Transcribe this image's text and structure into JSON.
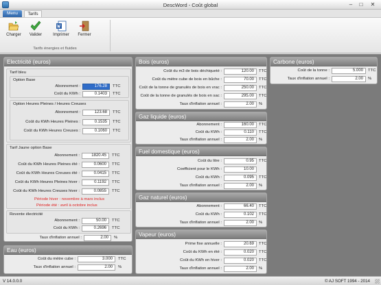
{
  "window": {
    "title": "DescWord - Coût global",
    "minimize": "–",
    "maximize": "□",
    "close": "✕"
  },
  "tabs": {
    "menu": "Menu",
    "tarifs": "Tarifs"
  },
  "ribbon": {
    "charger": "Charger",
    "valider": "Valider",
    "imprimer": "Imprimer",
    "fermer": "Fermer",
    "group": "Tarifs énergies et fluides"
  },
  "elec": {
    "title": "Electricité (euros)",
    "tarif_bleu": "Tarif bleu",
    "option_base": "Option Base",
    "base_abonnement": "Abonnement :",
    "base_abonnement_v": "176.28",
    "base_kwh": "Coût du KWh :",
    "base_kwh_v": "0.1403",
    "option_hphc": "Option Heures Pleines / Heures Creuses",
    "hp_abonnement": "Abonnement :",
    "hp_abonnement_v": "123.68",
    "hp_kwh_hp": "Coût du KWh Heures Pleines :",
    "hp_kwh_hp_v": "0.1535",
    "hp_kwh_hc": "Coût du KWh Heures Creuses :",
    "hp_kwh_hc_v": "0.1060",
    "tarif_jaune": "Tarif Jaune option Base",
    "tj_abonnement": "Abonnement :",
    "tj_abonnement_v": "1820.45",
    "tj_hp_ete": "Coût du KWh Heures Pleines été :",
    "tj_hp_ete_v": "0.0600",
    "tj_hc_ete": "Coût du KWh Heures Creuses été :",
    "tj_hc_ete_v": "0.0415",
    "tj_hp_hiver": "Coût du KWh Heures Pleines hiver :",
    "tj_hp_hiver_v": "0.1192",
    "tj_hc_hiver": "Coût du KWh Heures Creuses hiver :",
    "tj_hc_hiver_v": "0.0855",
    "periode_hiver": "Période hiver : novembre à mars inclus",
    "periode_ete": "Période été : avril à octobre inclus",
    "revente": "Revente électricité",
    "rev_abonnement": "Abonnement :",
    "rev_abonnement_v": "50.00",
    "rev_kwh": "Coût du KWh :",
    "rev_kwh_v": "0.2696",
    "inflation": "Taux d'inflation annuel :",
    "inflation_v": "2.00",
    "ttc": "TTC",
    "pct": "%"
  },
  "eau": {
    "title": "Eau (euros)",
    "m3": "Coût du mètre cube :",
    "m3_v": "3.000",
    "inflation": "Taux d'inflation annuel :",
    "inflation_v": "2.00",
    "ttc": "TTC",
    "pct": "%"
  },
  "bois": {
    "title": "Bois (euros)",
    "r1": "Coût du m3 de bois déchiqueté :",
    "r1_v": "120.00",
    "r2": "Coût du mètre cube de bois en bûche :",
    "r2_v": "70.00",
    "r3": "Coût de la tonne de granulés de bois en vrac :",
    "r3_v": "250.00",
    "r4": "Coût de la tonne de granulés de bois en sac :",
    "r4_v": "295.00",
    "inflation": "Taux d'inflation annuel :",
    "inflation_v": "2.00",
    "ttc": "TTC",
    "pct": "%"
  },
  "gaz_liquide": {
    "title": "Gaz liquide (euros)",
    "abonnement": "Abonnement :",
    "abonnement_v": "160.00",
    "kwh": "Coût du KWh :",
    "kwh_v": "0.110",
    "inflation": "Taux d'inflation annuel :",
    "inflation_v": "2.00",
    "ttc": "TTC",
    "pct": "%"
  },
  "fuel": {
    "title": "Fuel domestique (euros)",
    "litre": "Coût du litre :",
    "litre_v": "0.95",
    "coef": "Coefficient pour le KWh :",
    "coef_v": "10.00",
    "kwh": "Coût du KWh :",
    "kwh_v": "0.095",
    "inflation": "Taux d'inflation annuel :",
    "inflation_v": "2.00",
    "ttc": "TTC",
    "pct": "%"
  },
  "gaz_naturel": {
    "title": "Gaz naturel (euros)",
    "abonnement": "Abonnement :",
    "abonnement_v": "66.40",
    "kwh": "Coût du KWh :",
    "kwh_v": "0.102",
    "inflation": "Taux d'inflation annuel :",
    "inflation_v": "2.00",
    "ttc": "TTC",
    "pct": "%"
  },
  "vapeur": {
    "title": "Vapeur (euros)",
    "prime": "Prime fixe annuelle :",
    "prime_v": "20.69",
    "ete": "Coût du KWh en été :",
    "ete_v": "0.020",
    "hiver": "Coût du KWh en hiver :",
    "hiver_v": "0.020",
    "inflation": "Taux d'inflation annuel :",
    "inflation_v": "2.00",
    "ttc": "TTC",
    "pct": "%"
  },
  "carbone": {
    "title": "Carbone (euros)",
    "tonne": "Coût de la tonne :",
    "tonne_v": "5.000",
    "inflation": "Taux d'inflation annuel :",
    "inflation_v": "2.00",
    "ttc": "TTC",
    "pct": "%"
  },
  "status": {
    "version": "V 14.0.0.0",
    "copyright": "© AJ SOFT 1994 - 2014"
  }
}
